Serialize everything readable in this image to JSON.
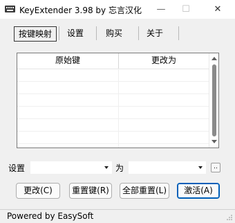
{
  "window": {
    "title": "KeyExtender 3.98 by 忘言汉化",
    "minimize_glyph": "—",
    "maximize_glyph": "☐",
    "close_glyph": "✕"
  },
  "tabs": [
    {
      "label": "按键映射",
      "active": true
    },
    {
      "label": "设置",
      "active": false
    },
    {
      "label": "购买",
      "active": false
    },
    {
      "label": "关于",
      "active": false
    }
  ],
  "list": {
    "columns": [
      "原始键",
      "更改为"
    ],
    "rows": []
  },
  "setting_row": {
    "label_set": "设置",
    "from_value": "",
    "label_to": "为",
    "to_value": "",
    "extra_button": ".."
  },
  "buttons": {
    "change": "更改(C)",
    "reset_key": "重置键(R)",
    "reset_all": "全部重置(L)",
    "activate": "激活(A)"
  },
  "status": {
    "text": "Powered by EasySoft"
  }
}
